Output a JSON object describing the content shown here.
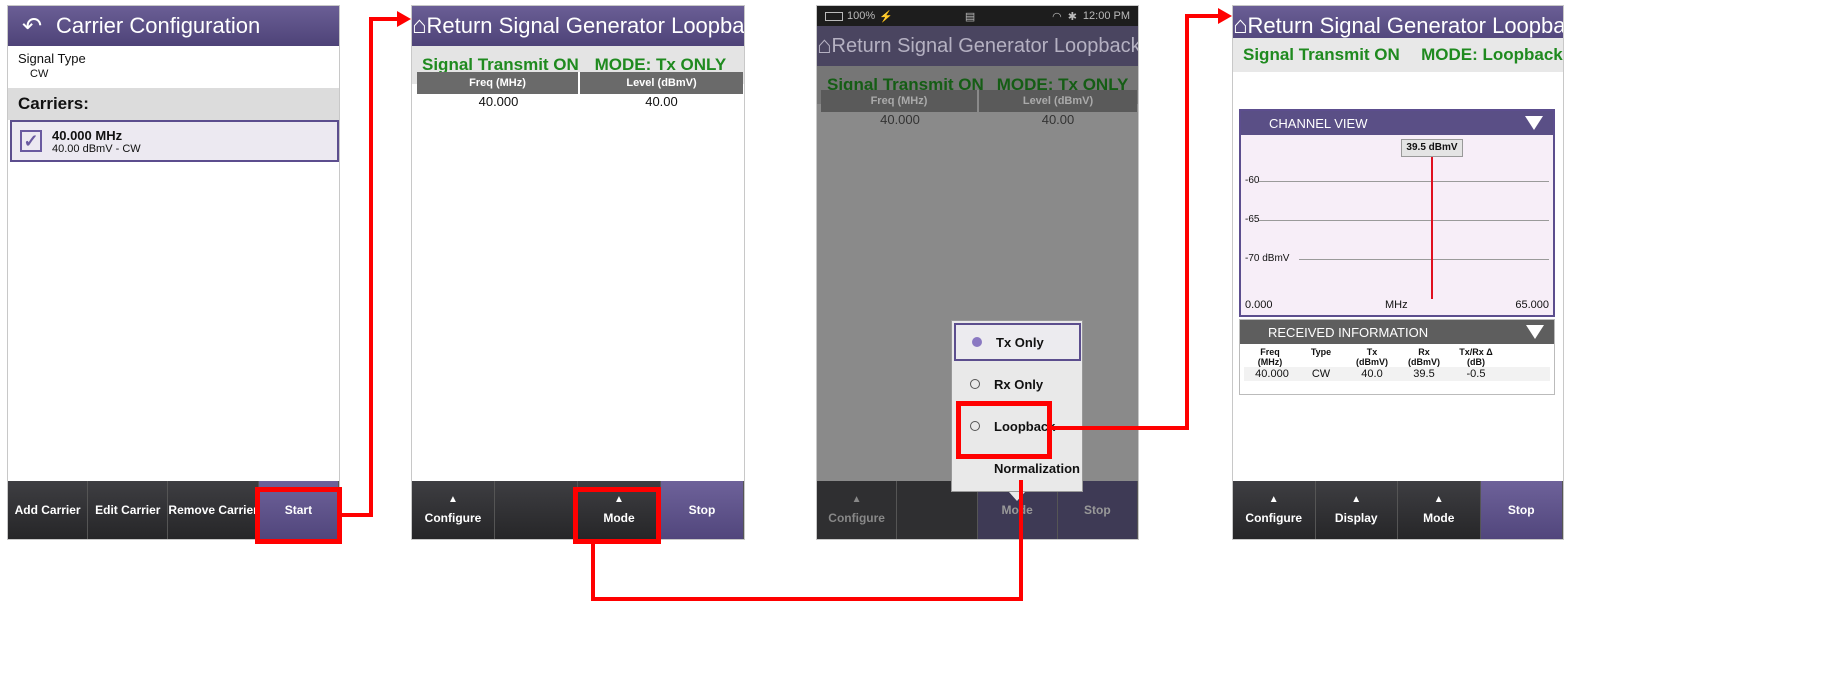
{
  "panel1": {
    "title": "Carrier Configuration",
    "signal_type_label": "Signal Type",
    "signal_type_value": "CW",
    "carriers_label": "Carriers:",
    "carrier_freq": "40.000 MHz",
    "carrier_detail": "40.00 dBmV - CW",
    "buttons": [
      "Add Carrier",
      "Edit Carrier",
      "Remove Carrier",
      "Start"
    ]
  },
  "panel2": {
    "title": "Return Signal Generator Loopback",
    "status": "Signal Transmit ON",
    "mode": "MODE: Tx ONLY",
    "col_freq": "Freq (MHz)",
    "col_level": "Level (dBmV)",
    "freq": "40.000",
    "level": "40.00",
    "buttons": [
      "Configure",
      "Mode",
      "Stop"
    ]
  },
  "panel3": {
    "battery": "100%",
    "time": "12:00 PM",
    "title": "Return Signal Generator Loopback",
    "status": "Signal Transmit ON",
    "mode": "MODE: Tx ONLY",
    "col_freq": "Freq (MHz)",
    "col_level": "Level (dBmV)",
    "freq": "40.000",
    "level": "40.00",
    "buttons": [
      "Configure",
      "Mode",
      "Stop"
    ],
    "menu": [
      "Tx Only",
      "Rx Only",
      "Loopback",
      "Normalization"
    ]
  },
  "panel4": {
    "title": "Return Signal Generator Loopback",
    "status": "Signal Transmit ON",
    "mode": "MODE: Loopback",
    "channel_view": "CHANNEL VIEW",
    "marker": "39.5 dBmV",
    "y_ticks": [
      "-60",
      "-65",
      "-70 dBmV"
    ],
    "x_min": "0.000",
    "x_label": "MHz",
    "x_max": "65.000",
    "received_info": "RECEIVED INFORMATION",
    "rx_headers": [
      "Freq\n(MHz)",
      "Type",
      "Tx\n(dBmV)",
      "Rx\n(dBmV)",
      "Tx/Rx Δ\n(dB)"
    ],
    "rx_row": [
      "40.000",
      "CW",
      "40.0",
      "39.5",
      "-0.5"
    ],
    "buttons": [
      "Configure",
      "Display",
      "Mode",
      "Stop"
    ]
  },
  "colors": {
    "header": "#5a4f86",
    "status_green": "#1f8a1f",
    "highlight": "#ff0000"
  }
}
